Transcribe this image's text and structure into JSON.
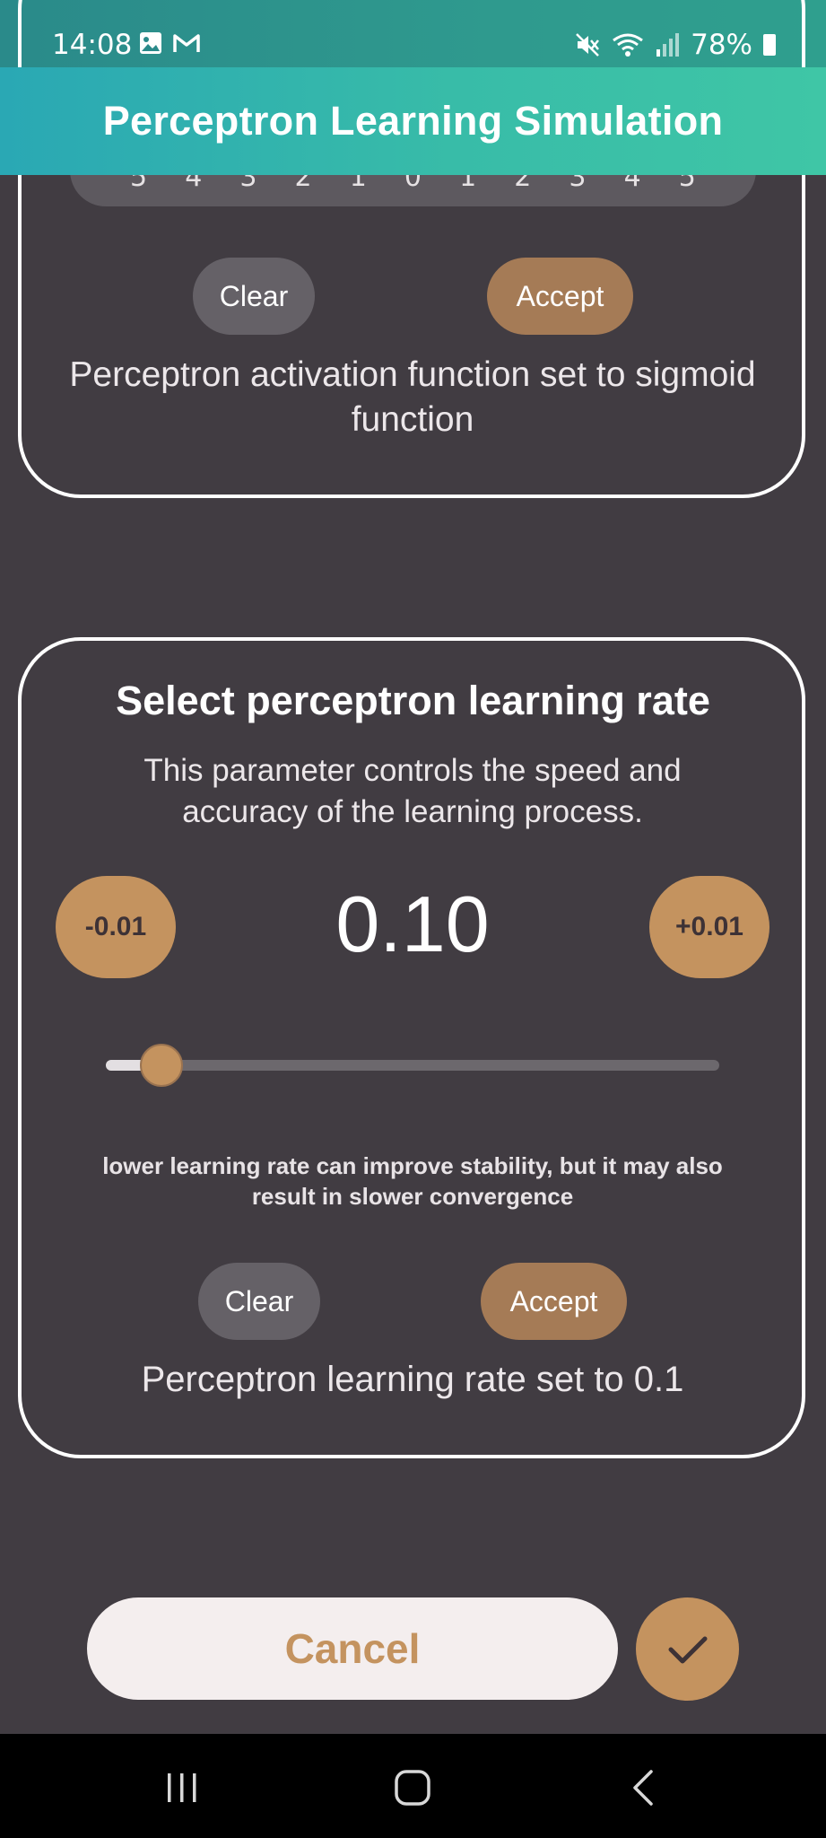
{
  "status_bar": {
    "time": "14:08",
    "battery": "78%",
    "left_icons": [
      "image-icon",
      "gmail-icon"
    ],
    "right_icons": [
      "mute-icon",
      "wifi-icon",
      "signal-icon",
      "battery-icon"
    ]
  },
  "app_bar": {
    "title": "Perceptron Learning Simulation"
  },
  "activation_card": {
    "scale_values": [
      "5",
      "4",
      "3",
      "2",
      "1",
      "0",
      "1",
      "2",
      "3",
      "4",
      "5"
    ],
    "clear_label": "Clear",
    "accept_label": "Accept",
    "status_message": "Perceptron activation function set to sigmoid function"
  },
  "learning_rate_card": {
    "title": "Select perceptron learning rate",
    "description": "This parameter controls the speed and accuracy of the learning process.",
    "decrement_label": "-0.01",
    "increment_label": "+0.01",
    "value": "0.10",
    "slider_fraction": 0.09,
    "hint": "lower learning rate can improve stability, but it may also result in slower convergence",
    "clear_label": "Clear",
    "accept_label": "Accept",
    "status_message": "Perceptron learning rate set to 0.1"
  },
  "actions": {
    "cancel_label": "Cancel",
    "confirm_icon": "check-icon"
  },
  "nav_bar": {
    "items": [
      "recents-icon",
      "home-icon",
      "back-icon"
    ]
  },
  "colors": {
    "background": "#413c42",
    "accent": "#c4935f",
    "accept_button": "#a57b56",
    "clear_button": "#656167",
    "app_bar": "#38bca8"
  }
}
